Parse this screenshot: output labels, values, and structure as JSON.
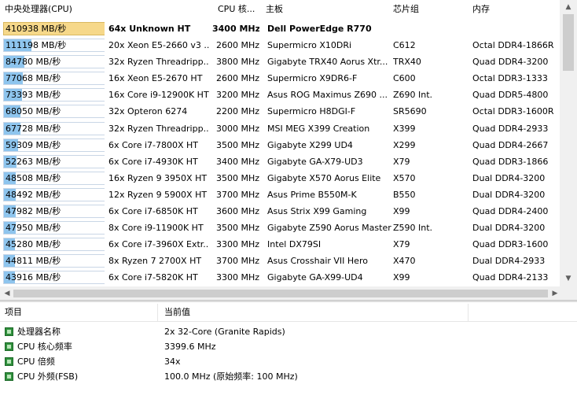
{
  "columns": [
    "中央处理器(CPU)",
    "CPU 核...",
    "主板",
    "芯片组",
    "内存"
  ],
  "rows": [
    {
      "score": "410938 MB/秒",
      "pct": 1.0,
      "cpu": "64x Unknown HT",
      "clock": "3400 MHz",
      "board": "Dell PowerEdge R770",
      "chipset": "",
      "memory": "",
      "selected": true
    },
    {
      "score": "111198 MB/秒",
      "pct": 0.271,
      "cpu": "20x Xeon E5-2660 v3 ...",
      "clock": "2600 MHz",
      "board": "Supermicro X10DRi",
      "chipset": "C612",
      "memory": "Octal DDR4-1866R"
    },
    {
      "score": "84780 MB/秒",
      "pct": 0.206,
      "cpu": "32x Ryzen Threadripp...",
      "clock": "3800 MHz",
      "board": "Gigabyte TRX40 Aorus Xtr...",
      "chipset": "TRX40",
      "memory": "Quad DDR4-3200"
    },
    {
      "score": "77068 MB/秒",
      "pct": 0.188,
      "cpu": "16x Xeon E5-2670 HT",
      "clock": "2600 MHz",
      "board": "Supermicro X9DR6-F",
      "chipset": "C600",
      "memory": "Octal DDR3-1333"
    },
    {
      "score": "73393 MB/秒",
      "pct": 0.179,
      "cpu": "16x Core i9-12900K HT",
      "clock": "3200 MHz",
      "board": "Asus ROG Maximus Z690 ...",
      "chipset": "Z690 Int.",
      "memory": "Quad DDR5-4800"
    },
    {
      "score": "68050 MB/秒",
      "pct": 0.166,
      "cpu": "32x Opteron 6274",
      "clock": "2200 MHz",
      "board": "Supermicro H8DGI-F",
      "chipset": "SR5690",
      "memory": "Octal DDR3-1600R"
    },
    {
      "score": "67728 MB/秒",
      "pct": 0.165,
      "cpu": "32x Ryzen Threadripp...",
      "clock": "3000 MHz",
      "board": "MSI MEG X399 Creation",
      "chipset": "X399",
      "memory": "Quad DDR4-2933"
    },
    {
      "score": "59309 MB/秒",
      "pct": 0.144,
      "cpu": "6x Core i7-7800X HT",
      "clock": "3500 MHz",
      "board": "Gigabyte X299 UD4",
      "chipset": "X299",
      "memory": "Quad DDR4-2667"
    },
    {
      "score": "52263 MB/秒",
      "pct": 0.127,
      "cpu": "6x Core i7-4930K HT",
      "clock": "3400 MHz",
      "board": "Gigabyte GA-X79-UD3",
      "chipset": "X79",
      "memory": "Quad DDR3-1866"
    },
    {
      "score": "48508 MB/秒",
      "pct": 0.118,
      "cpu": "16x Ryzen 9 3950X HT",
      "clock": "3500 MHz",
      "board": "Gigabyte X570 Aorus Elite",
      "chipset": "X570",
      "memory": "Dual DDR4-3200"
    },
    {
      "score": "48492 MB/秒",
      "pct": 0.118,
      "cpu": "12x Ryzen 9 5900X HT",
      "clock": "3700 MHz",
      "board": "Asus Prime B550M-K",
      "chipset": "B550",
      "memory": "Dual DDR4-3200"
    },
    {
      "score": "47982 MB/秒",
      "pct": 0.117,
      "cpu": "6x Core i7-6850K HT",
      "clock": "3600 MHz",
      "board": "Asus Strix X99 Gaming",
      "chipset": "X99",
      "memory": "Quad DDR4-2400"
    },
    {
      "score": "47950 MB/秒",
      "pct": 0.117,
      "cpu": "8x Core i9-11900K HT",
      "clock": "3500 MHz",
      "board": "Gigabyte Z590 Aorus Master",
      "chipset": "Z590 Int.",
      "memory": "Dual DDR4-3200"
    },
    {
      "score": "45280 MB/秒",
      "pct": 0.11,
      "cpu": "6x Core i7-3960X Extr...",
      "clock": "3300 MHz",
      "board": "Intel DX79SI",
      "chipset": "X79",
      "memory": "Quad DDR3-1600"
    },
    {
      "score": "44811 MB/秒",
      "pct": 0.109,
      "cpu": "8x Ryzen 7 2700X HT",
      "clock": "3700 MHz",
      "board": "Asus Crosshair VII Hero",
      "chipset": "X470",
      "memory": "Dual DDR4-2933"
    },
    {
      "score": "43916 MB/秒",
      "pct": 0.107,
      "cpu": "6x Core i7-5820K HT",
      "clock": "3300 MHz",
      "board": "Gigabyte GA-X99-UD4",
      "chipset": "X99",
      "memory": "Quad DDR4-2133"
    }
  ],
  "details": {
    "col_item": "项目",
    "col_value": "当前值",
    "items": [
      {
        "label": "处理器名称",
        "value": "2x 32-Core  (Granite Rapids)"
      },
      {
        "label": "CPU 核心频率",
        "value": "3399.6 MHz"
      },
      {
        "label": "CPU 倍频",
        "value": "34x"
      },
      {
        "label": "CPU 外频(FSB)",
        "value": "100.0 MHz  (原始频率:  100 MHz)"
      }
    ]
  },
  "icons": {
    "scroll_up": "arrow-up-icon",
    "scroll_down": "arrow-down-icon",
    "scroll_left": "arrow-left-icon",
    "scroll_right": "arrow-right-icon",
    "item": "green-square-icon"
  },
  "colors": {
    "bar": "#8ec5ee",
    "bar_selected": "#f6d88a",
    "icon": "#2f8f3c"
  }
}
